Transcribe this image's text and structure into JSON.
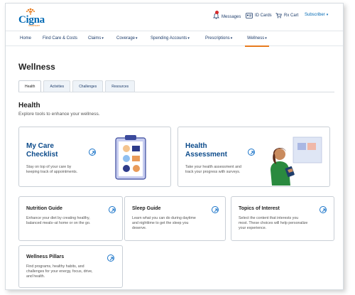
{
  "brand": {
    "name": "Cigna",
    "sub": "healthcare"
  },
  "header": {
    "messages": "Messages",
    "id_cards": "ID Cards",
    "rx_cart": "Rx Cart",
    "user": "Subscriber"
  },
  "nav": [
    {
      "label": "Home"
    },
    {
      "label": "Find Care & Costs"
    },
    {
      "label": "Claims"
    },
    {
      "label": "Coverage"
    },
    {
      "label": "Spending Accounts"
    },
    {
      "label": "Prescriptions"
    },
    {
      "label": "Wellness"
    }
  ],
  "page": {
    "title": "Wellness"
  },
  "tabs": [
    {
      "label": "Health"
    },
    {
      "label": "Activities"
    },
    {
      "label": "Challenges"
    },
    {
      "label": "Resources"
    }
  ],
  "section": {
    "title": "Health",
    "subtitle": "Explore tools to enhance your wellness."
  },
  "cards": {
    "checklist": {
      "title1": "My Care",
      "title2": "Checklist",
      "desc1": "Stay on top of your care by",
      "desc2": "keeping track of appointments."
    },
    "assessment": {
      "title1": "Health",
      "title2": "Assessment",
      "desc1": "Take your health assessment and",
      "desc2": "track your progress with surveys."
    },
    "nutrition": {
      "title": "Nutrition Guide",
      "desc1": "Enhance your diet by creating healthy,",
      "desc2": "balanced meals–at home or on the go."
    },
    "sleep": {
      "title": "Sleep Guide",
      "desc1": "Learn what you can do during daytime",
      "desc2": "and nighttime to get the sleep you",
      "desc3": "deserve."
    },
    "topics": {
      "title": "Topics of Interest",
      "desc1": "Select the content that interests you",
      "desc2": "most. These choices will help personalize",
      "desc3": "your experience."
    },
    "pillars": {
      "title": "Wellness Pillars",
      "desc1": "Find programs, healthy habits, and",
      "desc2": "challenges for your energy, focus, drive,",
      "desc3": "and health."
    }
  },
  "colors": {
    "brand_blue": "#0069b4",
    "accent_orange": "#e77b1e",
    "link_blue": "#1a74c9"
  }
}
